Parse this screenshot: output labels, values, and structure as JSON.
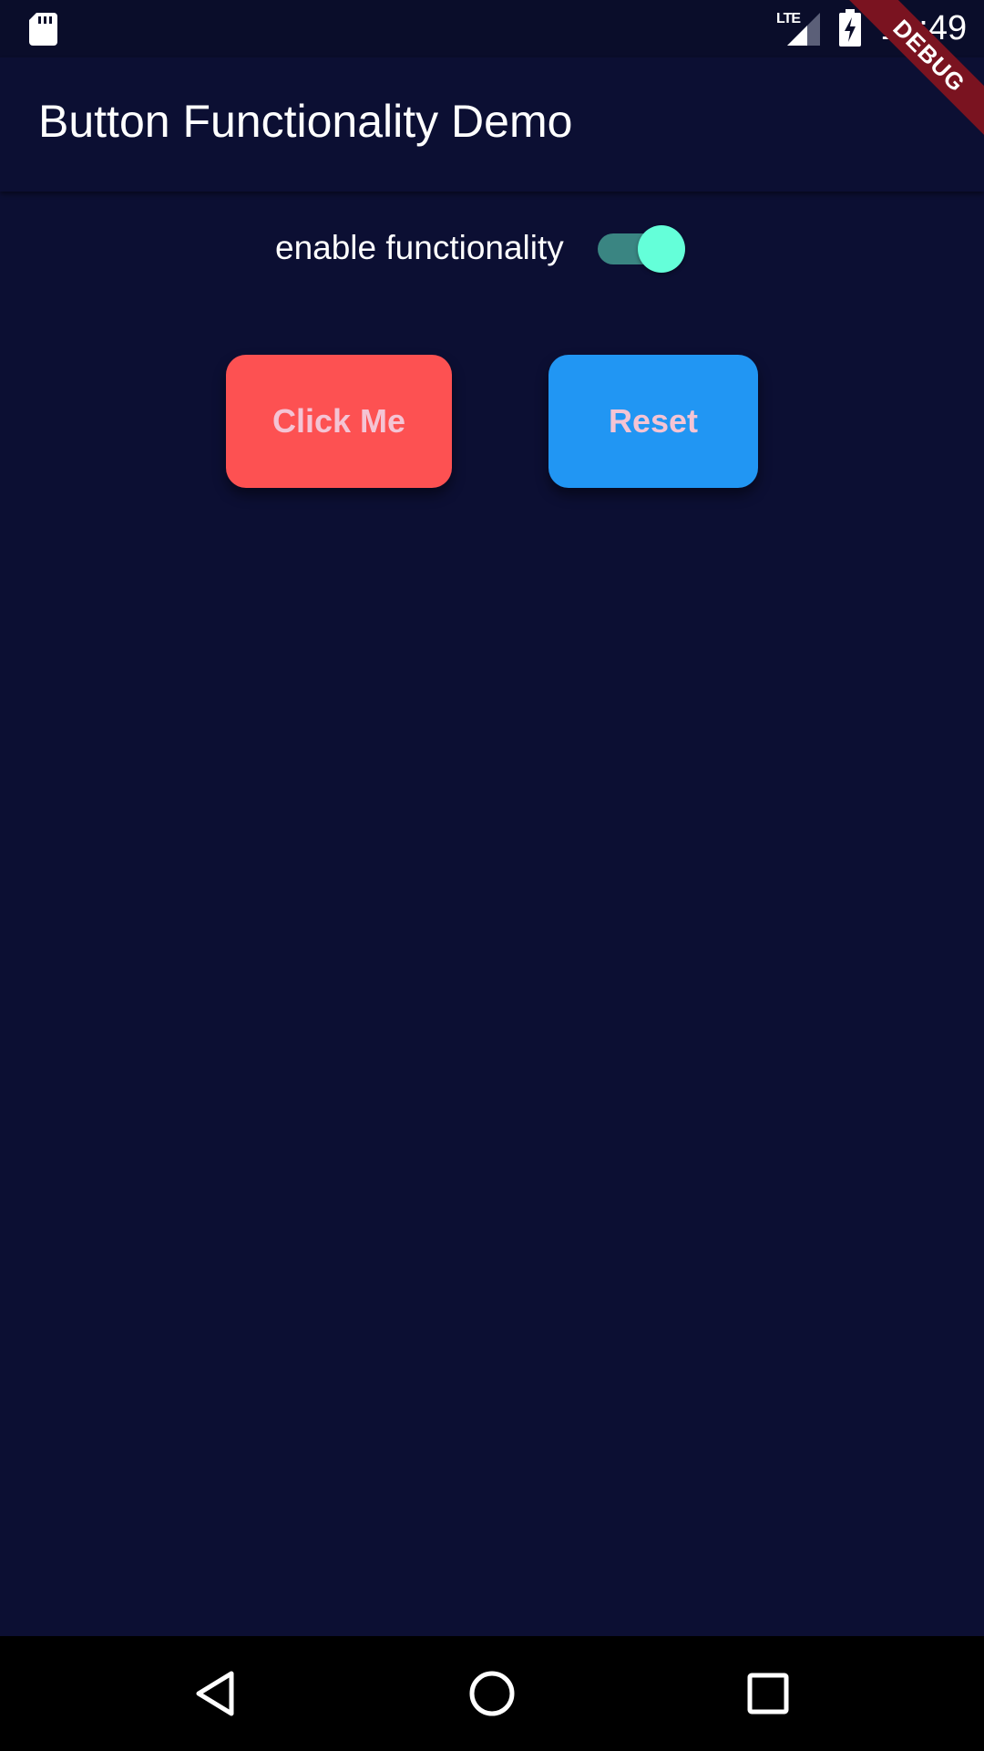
{
  "status_bar": {
    "time": "12:49",
    "network": "LTE",
    "icons": [
      "sd-card-icon",
      "signal-icon",
      "battery-charging-icon"
    ]
  },
  "debug_banner": {
    "label": "DEBUG"
  },
  "app_bar": {
    "title": "Button Functionality Demo"
  },
  "toggle": {
    "label": "enable functionality",
    "enabled": true,
    "track_color": "#3a8582",
    "thumb_color": "#64ffd9"
  },
  "buttons": {
    "click_me": {
      "label": "Click Me",
      "color": "#fd5152"
    },
    "reset": {
      "label": "Reset",
      "color": "#2196f3"
    }
  },
  "nav_bar": {
    "icons": [
      "back-icon",
      "home-icon",
      "recents-icon"
    ]
  },
  "colors": {
    "background": "#0c0f33",
    "button_text": "#f4c4d4"
  }
}
